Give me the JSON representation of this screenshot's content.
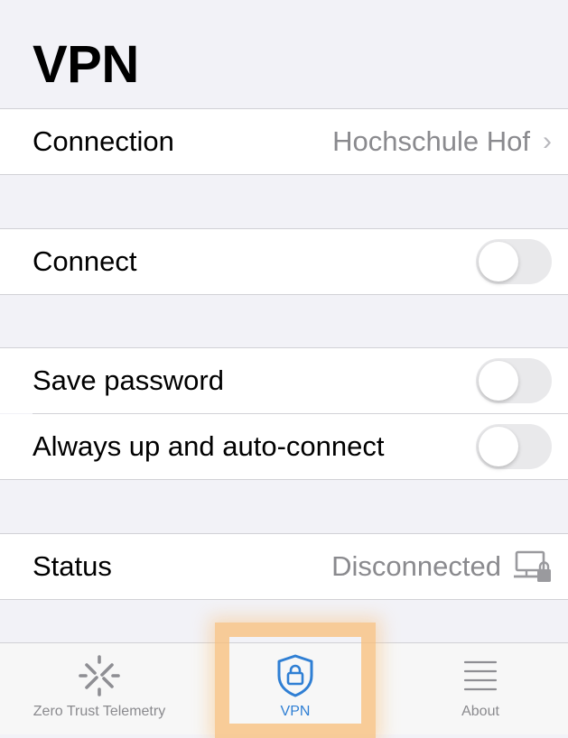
{
  "header": {
    "title": "VPN"
  },
  "connection": {
    "label": "Connection",
    "value": "Hochschule Hof"
  },
  "connect": {
    "label": "Connect",
    "enabled": false
  },
  "save_password": {
    "label": "Save password",
    "enabled": false
  },
  "always_up": {
    "label": "Always up and auto-connect",
    "enabled": false
  },
  "status": {
    "label": "Status",
    "value": "Disconnected",
    "icon": "computer-lock-icon"
  },
  "tabbar": {
    "tabs": [
      {
        "label": "Zero Trust Telemetry",
        "icon": "telemetry-icon"
      },
      {
        "label": "VPN",
        "icon": "shield-lock-icon",
        "active": true
      },
      {
        "label": "About",
        "icon": "list-icon"
      }
    ]
  },
  "colors": {
    "accent": "#2f7fd4",
    "background": "#f2f2f7",
    "secondary_text": "#8a8a8e",
    "highlight": "#f8be78"
  }
}
